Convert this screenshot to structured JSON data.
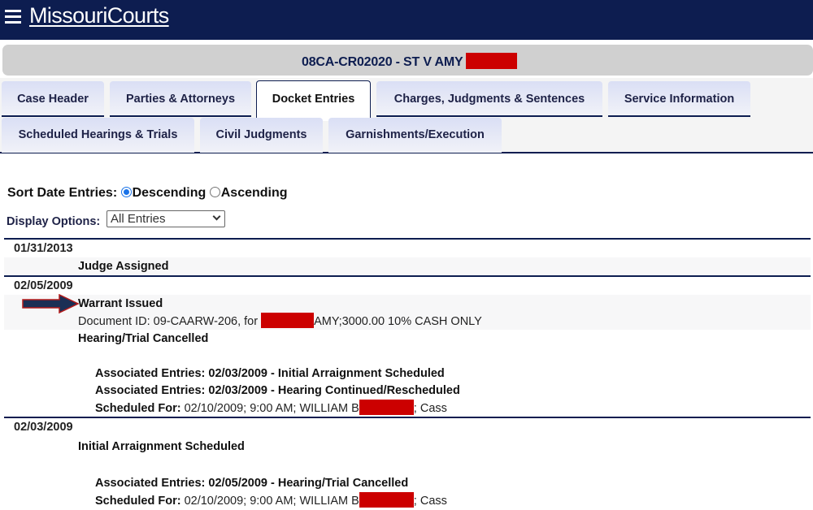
{
  "header": {
    "menu_icon": "hamburger-menu-icon",
    "brand": "MissouriCourts",
    "colors": {
      "navy": "#0d1d50",
      "redaction": "#cc0000",
      "radio_accent": "#1a73e8"
    }
  },
  "case": {
    "title": "08CA-CR02020 - ST V AMY",
    "redacted": true
  },
  "tabs": [
    {
      "label": "Case Header",
      "active": false
    },
    {
      "label": "Parties & Attorneys",
      "active": false
    },
    {
      "label": "Docket Entries",
      "active": true
    },
    {
      "label": "Charges, Judgments & Sentences",
      "active": false
    },
    {
      "label": "Service Information",
      "active": false
    },
    {
      "label": "Scheduled Hearings & Trials",
      "active": false
    },
    {
      "label": "Civil Judgments",
      "active": false
    },
    {
      "label": "Garnishments/Execution",
      "active": false
    }
  ],
  "sort": {
    "label": "Sort Date Entries:",
    "options": [
      {
        "label": "Descending",
        "checked": true
      },
      {
        "label": "Ascending",
        "checked": false
      }
    ]
  },
  "display_options": {
    "label": "Display Options:",
    "selected": "All Entries"
  },
  "docket": {
    "groups": [
      {
        "date": "01/31/2013",
        "entries": [
          {
            "title": "Judge Assigned"
          }
        ]
      },
      {
        "date": "02/05/2009",
        "entries": [
          {
            "title": "Warrant Issued",
            "highlighted_by_arrow": true,
            "text_before": "Document ID: 09-CAARW-206, for",
            "text_after": "AMY;3000.00 10% CASH ONLY"
          },
          {
            "title": "Hearing/Trial Cancelled",
            "associated": [
              "Associated Entries: 02/03/2009 - Initial Arraignment Scheduled",
              "Associated Entries: 02/03/2009 - Hearing Continued/Rescheduled"
            ],
            "scheduled_label": "Scheduled For:",
            "scheduled_before": "02/10/2009; 9:00 AM; WILLIAM B",
            "scheduled_after": "; Cass"
          }
        ]
      },
      {
        "date": "02/03/2009",
        "entries": [
          {
            "title": "Initial Arraignment Scheduled",
            "associated": [
              "Associated Entries: 02/05/2009 - Hearing/Trial Cancelled"
            ],
            "scheduled_label": "Scheduled For:",
            "scheduled_before": "02/10/2009; 9:00 AM; WILLIAM B",
            "scheduled_after": "; Cass"
          }
        ]
      }
    ]
  }
}
